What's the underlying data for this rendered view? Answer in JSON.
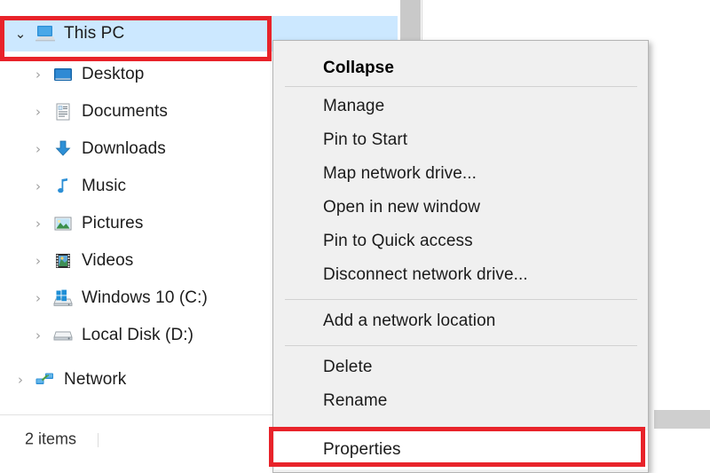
{
  "window": {
    "app": "File Explorer",
    "status_bar": {
      "item_count": "2 items"
    }
  },
  "colors": {
    "selection_blue": "#cce8ff",
    "annotation_red": "#e8232a",
    "menu_background": "#f0f0f0",
    "menu_border": "#b4b4b4",
    "highlight_white": "#ffffff",
    "scrollbar_thumb": "#c9c9c9"
  },
  "nav_tree": {
    "items": [
      {
        "label": "This PC",
        "icon": "this-pc-icon",
        "chevron": "expanded",
        "level": 0,
        "selected": true
      },
      {
        "label": "Desktop",
        "icon": "desktop-icon",
        "chevron": "collapsed",
        "level": 1,
        "selected": false
      },
      {
        "label": "Documents",
        "icon": "documents-icon",
        "chevron": "collapsed",
        "level": 1,
        "selected": false
      },
      {
        "label": "Downloads",
        "icon": "downloads-icon",
        "chevron": "collapsed",
        "level": 1,
        "selected": false
      },
      {
        "label": "Music",
        "icon": "music-icon",
        "chevron": "collapsed",
        "level": 1,
        "selected": false
      },
      {
        "label": "Pictures",
        "icon": "pictures-icon",
        "chevron": "collapsed",
        "level": 1,
        "selected": false
      },
      {
        "label": "Videos",
        "icon": "videos-icon",
        "chevron": "collapsed",
        "level": 1,
        "selected": false
      },
      {
        "label": "Windows 10 (C:)",
        "icon": "os-drive-icon",
        "chevron": "collapsed",
        "level": 1,
        "selected": false
      },
      {
        "label": "Local Disk (D:)",
        "icon": "hard-drive-icon",
        "chevron": "collapsed",
        "level": 1,
        "selected": false
      },
      {
        "label": "Network",
        "icon": "network-icon",
        "chevron": "collapsed",
        "level": 0,
        "selected": false
      }
    ],
    "chevron_glyphs": {
      "expanded": "⌄",
      "collapsed": "›"
    }
  },
  "context_menu": {
    "items": [
      {
        "label": "Collapse",
        "bold": true,
        "highlighted": false
      },
      {
        "label": "Manage",
        "bold": false,
        "highlighted": false
      },
      {
        "label": "Pin to Start",
        "bold": false,
        "highlighted": false
      },
      {
        "label": "Map network drive...",
        "bold": false,
        "highlighted": false
      },
      {
        "label": "Open in new window",
        "bold": false,
        "highlighted": false
      },
      {
        "label": "Pin to Quick access",
        "bold": false,
        "highlighted": false
      },
      {
        "label": "Disconnect network drive...",
        "bold": false,
        "highlighted": false
      },
      {
        "label": "Add a network location",
        "bold": false,
        "highlighted": false
      },
      {
        "label": "Delete",
        "bold": false,
        "highlighted": false
      },
      {
        "label": "Rename",
        "bold": false,
        "highlighted": false
      },
      {
        "label": "Properties",
        "bold": false,
        "highlighted": true
      }
    ]
  },
  "annotations": [
    {
      "name": "this-pc-highlight",
      "target": "This PC"
    },
    {
      "name": "properties-highlight",
      "target": "Properties"
    }
  ]
}
